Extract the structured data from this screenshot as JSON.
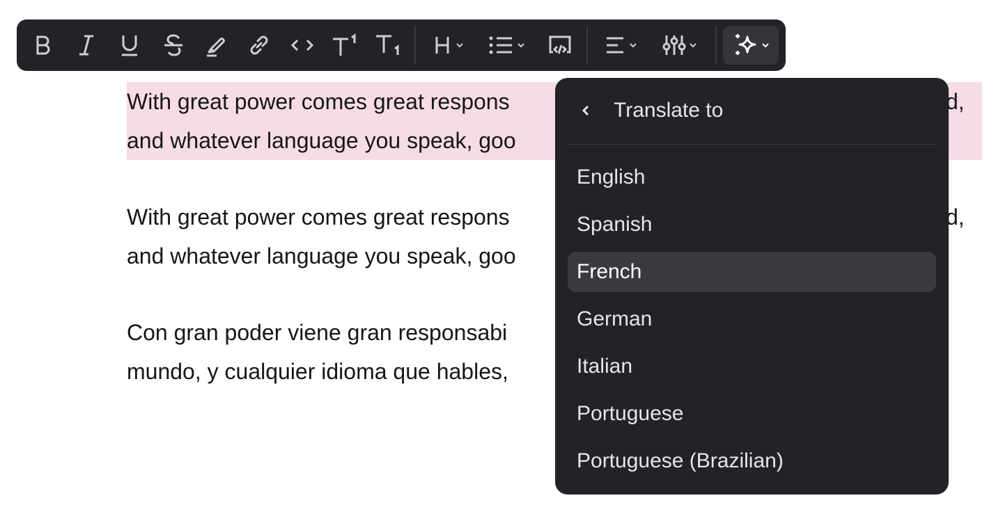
{
  "toolbar": {
    "buttons": [
      {
        "name": "bold-button",
        "icon": "bold-icon"
      },
      {
        "name": "italic-button",
        "icon": "italic-icon"
      },
      {
        "name": "underline-button",
        "icon": "underline-icon"
      },
      {
        "name": "strikethrough-button",
        "icon": "strikethrough-icon"
      },
      {
        "name": "highlight-button",
        "icon": "highlighter-icon"
      },
      {
        "name": "link-button",
        "icon": "link-icon"
      },
      {
        "name": "code-button",
        "icon": "code-icon"
      },
      {
        "name": "superscript-button",
        "icon": "superscript-icon"
      },
      {
        "name": "subscript-button",
        "icon": "subscript-icon"
      },
      {
        "name": "heading-dropdown",
        "icon": "heading-icon"
      },
      {
        "name": "list-dropdown",
        "icon": "bulleted-list-icon"
      },
      {
        "name": "embed-button",
        "icon": "embed-icon"
      },
      {
        "name": "align-dropdown",
        "icon": "align-left-icon"
      },
      {
        "name": "adjustments-dropdown",
        "icon": "sliders-icon"
      },
      {
        "name": "ai-actions-dropdown",
        "icon": "sparkle-icon",
        "active": true
      }
    ],
    "heading_glyph": "H"
  },
  "document": {
    "paragraphs": [
      {
        "highlighted": true,
        "lines": [
          "With great power comes great respons",
          "and whatever language you speak, goo"
        ],
        "trailing": "d,"
      },
      {
        "highlighted": false,
        "lines": [
          "With great power comes great respons",
          "and whatever language you speak, goo"
        ],
        "trailing": "d,"
      },
      {
        "highlighted": false,
        "lines": [
          "Con gran poder viene gran responsabi",
          "mundo, y cualquier idioma que hables,"
        ],
        "trailing": ""
      }
    ]
  },
  "translate_menu": {
    "title": "Translate to",
    "back_icon": "chevron-left-icon",
    "options": [
      "English",
      "Spanish",
      "French",
      "German",
      "Italian",
      "Portuguese",
      "Portuguese (Brazilian)"
    ],
    "selected": "French"
  },
  "colors": {
    "toolbar_bg": "#222326",
    "menu_bg": "#222326",
    "highlight": "#f7dce8",
    "selected_item": "#3a3b40"
  }
}
